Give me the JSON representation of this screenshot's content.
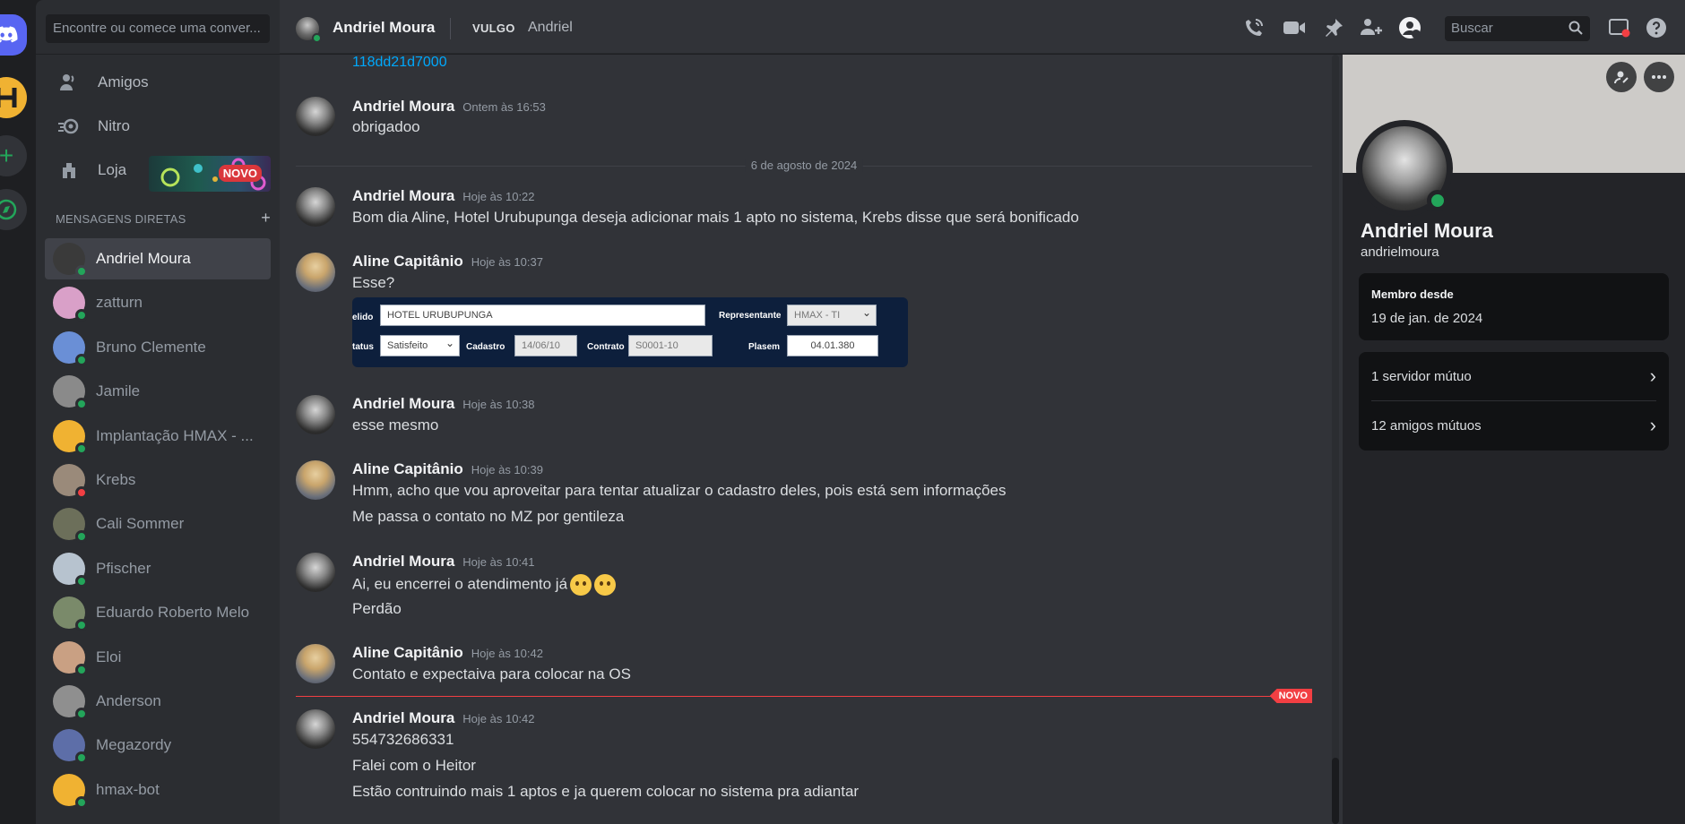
{
  "sidebar": {
    "search_placeholder": "Encontre ou comece uma conver...",
    "nav": [
      {
        "label": "Amigos"
      },
      {
        "label": "Nitro"
      },
      {
        "label": "Loja"
      }
    ],
    "loja_badge": "NOVO",
    "dm_header": "MENSAGENS DIRETAS",
    "dm_add": "+",
    "dms": [
      {
        "label": "Andriel Moura",
        "status": "online"
      },
      {
        "label": "zatturn",
        "status": "online"
      },
      {
        "label": "Bruno Clemente",
        "status": "online"
      },
      {
        "label": "Jamile",
        "status": "online"
      },
      {
        "label": "Implantação HMAX - ...",
        "status": "online"
      },
      {
        "label": "Krebs",
        "status": "dnd"
      },
      {
        "label": "Cali Sommer",
        "status": "online"
      },
      {
        "label": "Pfischer",
        "status": "online"
      },
      {
        "label": "Eduardo Roberto Melo",
        "status": "online"
      },
      {
        "label": "Eloi",
        "status": "online"
      },
      {
        "label": "Anderson",
        "status": "online"
      },
      {
        "label": "Megazordy",
        "status": "online"
      },
      {
        "label": "hmax-bot",
        "status": "online"
      }
    ]
  },
  "header": {
    "name": "Andriel Moura",
    "tag": "VULGO",
    "alias": "Andriel",
    "search_placeholder": "Buscar"
  },
  "chat": {
    "link_fragment": "118dd21d7000",
    "date_divider": "6 de agosto de 2024",
    "new_divider": "NOVO",
    "messages": [
      {
        "author": "Andriel Moura",
        "time": "Ontem às 16:53",
        "lines": [
          "obrigadoo"
        ]
      },
      {
        "author": "Andriel Moura",
        "time": "Hoje às 10:22",
        "lines": [
          "Bom dia Aline, Hotel Urubupunga deseja adicionar mais 1 apto no sistema, Krebs disse que será bonificado"
        ]
      },
      {
        "author": "Aline Capitânio",
        "time": "Hoje às 10:37",
        "lines": [
          "Esse?"
        ]
      },
      {
        "author": "Andriel Moura",
        "time": "Hoje às 10:38",
        "lines": [
          "esse mesmo"
        ]
      },
      {
        "author": "Aline Capitânio",
        "time": "Hoje às 10:39",
        "lines": [
          "Hmm, acho que vou aproveitar para tentar atualizar o cadastro deles, pois está sem informações",
          "Me passa o contato no MZ por gentileza"
        ]
      },
      {
        "author": "Andriel Moura",
        "time": "Hoje às 10:41",
        "lines": [
          "Ai, eu encerrei o atendimento já",
          "Perdão"
        ]
      },
      {
        "author": "Aline Capitânio",
        "time": "Hoje às 10:42",
        "lines": [
          "Contato e expectaiva para colocar na OS"
        ]
      },
      {
        "author": "Andriel Moura",
        "time": "Hoje às 10:42",
        "lines": [
          "554732686331",
          "Falei com o Heitor",
          "Estão contruindo mais 1 aptos e ja querem colocar no sistema pra adiantar"
        ]
      }
    ],
    "embed": {
      "l_apelido": "elido",
      "f_apelido": "HOTEL URUBUPUNGA",
      "l_representante": "Representante",
      "f_representante": "HMAX - TI",
      "l_status": "tatus",
      "f_status": "Satisfeito",
      "l_cadastro": "Cadastro",
      "f_cadastro": "14/06/10",
      "l_contrato": "Contrato",
      "f_contrato": "S0001-10",
      "l_plasem": "Plasem",
      "f_plasem": "04.01.380"
    }
  },
  "profile": {
    "name": "Andriel Moura",
    "username": "andrielmoura",
    "member_since_label": "Membro desde",
    "member_since_value": "19 de jan. de 2024",
    "mutual_servers": "1 servidor mútuo",
    "mutual_friends": "12 amigos mútuos"
  },
  "colors": {
    "accent": "#5865f2",
    "online": "#23a55a",
    "dnd": "#f23f43",
    "link": "#00a8fc"
  }
}
